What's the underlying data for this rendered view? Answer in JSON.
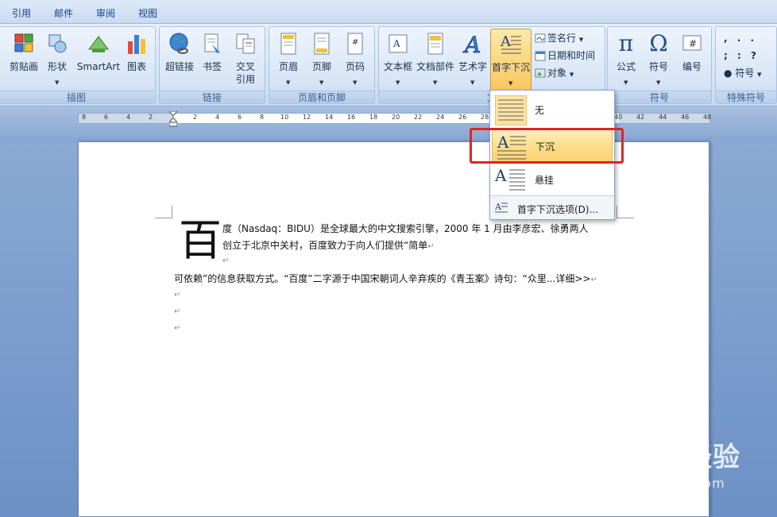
{
  "tabs": [
    "引用",
    "邮件",
    "审阅",
    "视图"
  ],
  "groups": {
    "illustrations": {
      "label": "插图",
      "buttons": [
        "剪贴画",
        "形状",
        "SmartArt",
        "图表"
      ]
    },
    "links": {
      "label": "链接",
      "buttons": [
        "超链接",
        "书签",
        "交叉",
        "引用"
      ]
    },
    "header_footer": {
      "label": "页眉和页脚",
      "buttons": [
        "页眉",
        "页脚",
        "页码"
      ]
    },
    "text": {
      "label": "文",
      "buttons": [
        "文本框",
        "文档部件",
        "艺术字",
        "首字下沉"
      ],
      "small": [
        "签名行",
        "日期和时间",
        "对象"
      ]
    },
    "symbols": {
      "label": "符号",
      "buttons": [
        "公式",
        "符号",
        "编号"
      ],
      "glyphs": [
        "π",
        "Ω",
        "#"
      ]
    },
    "special": {
      "label": "特殊符号",
      "glyphs": [
        ", . .",
        "; : ?"
      ],
      "button": "符号"
    }
  },
  "ruler_numbers": [
    "8",
    "6",
    "4",
    "2",
    "2",
    "4",
    "6",
    "8",
    "10",
    "12",
    "14",
    "16",
    "18",
    "20",
    "22",
    "24",
    "26",
    "28",
    "40",
    "42",
    "44",
    "46",
    "48"
  ],
  "dropdown": {
    "items": [
      "无",
      "下沉",
      "悬挂"
    ],
    "footer": "首字下沉选项(D)..."
  },
  "document": {
    "dropcap": "百",
    "line1": "度（Nasdaq：BIDU）是全球最大的中文搜索引擎，2000 年 1 月由李彦宏、徐勇两人",
    "line2": "创立于北京中关村，百度致力于向人们提供“简单",
    "line3": "可依赖”的信息获取方式。“百度”二字源于中国宋朝词人辛弃疾的《青玉案》诗句：“众里...详细>>",
    "para_mark": "↵"
  },
  "watermark": {
    "main": "Baidu经验",
    "sub": "jingyan.baidu.com"
  },
  "colors": {
    "accent": "#f8c65c",
    "highlight": "#e02424",
    "ribbon": "#d7e5f6"
  }
}
